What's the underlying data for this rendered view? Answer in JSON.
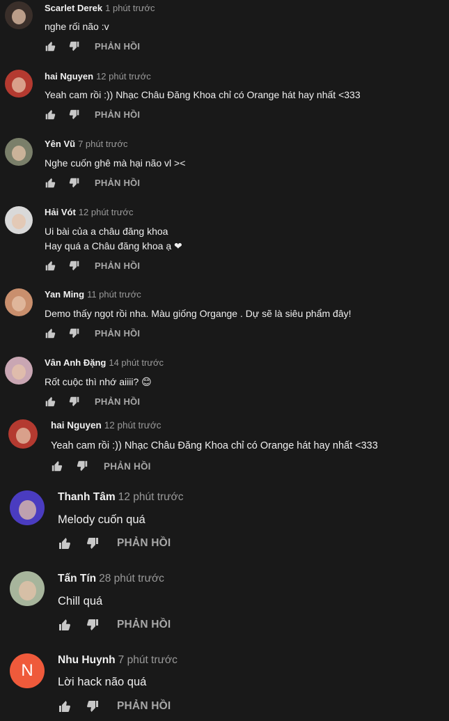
{
  "comments": [
    {
      "author": "Scarlet Derek",
      "time": "1 phút trước",
      "text": "nghe rối não :v",
      "reply": "PHẢN HỒI",
      "avatar_color": "#3a2f2a"
    },
    {
      "author": "hai Nguyen",
      "time": "12 phút trước",
      "text": "Yeah cam rồi :)) Nhạc Châu Đăng Khoa chỉ có Orange hát hay nhất <333",
      "reply": "PHẢN HỒI",
      "avatar_color": "#b43a30"
    },
    {
      "author": "Yên Vũ",
      "time": "7 phút trước",
      "text": "Nghe cuốn ghê mà hại não vl ><",
      "reply": "PHẢN HỒI",
      "avatar_color": "#7a7f6a"
    },
    {
      "author": "Hải Vót",
      "time": "12 phút trước",
      "text": "Ui bài của a châu đăng khoa\nHay quá a Châu đăng khoa ạ ❤",
      "reply": "PHẢN HỒI",
      "avatar_color": "#d9d9d9"
    },
    {
      "author": "Yan Ming",
      "time": "11 phút trước",
      "text": "Demo thấy ngọt rồi nha. Màu giống Organge . Dự sẽ là siêu phẩm đây!",
      "reply": "PHẢN HỒI",
      "avatar_color": "#c98f6d"
    },
    {
      "author": "Vân Anh Đặng",
      "time": "14 phút trước",
      "text": "Rốt cuộc thì nhớ aiiii? 😊",
      "reply": "PHẢN HỒI",
      "avatar_color": "#c9a6b3"
    },
    {
      "author": "hai Nguyen",
      "time": "12 phút trước",
      "text": "Yeah cam rồi :)) Nhạc Châu Đăng Khoa chỉ có Orange hát hay nhất <333",
      "reply": "PHẢN HỒI",
      "avatar_color": "#b43a30"
    },
    {
      "author": "Thanh Tâm",
      "time": "12 phút trước",
      "text": "Melody cuốn quá",
      "reply": "PHẢN HỒI",
      "avatar_color": "#4a3cc0"
    },
    {
      "author": "Tấn Tín",
      "time": "28 phút trước",
      "text": "Chill quá",
      "reply": "PHẢN HỒI",
      "avatar_color": "#a7b59c"
    },
    {
      "author": "Nhu Huynh",
      "time": "7 phút trước",
      "text": "Lời hack não quá",
      "reply": "PHẢN HỒI",
      "avatar_letter": "N",
      "avatar_color": "#ef5a3b"
    }
  ]
}
